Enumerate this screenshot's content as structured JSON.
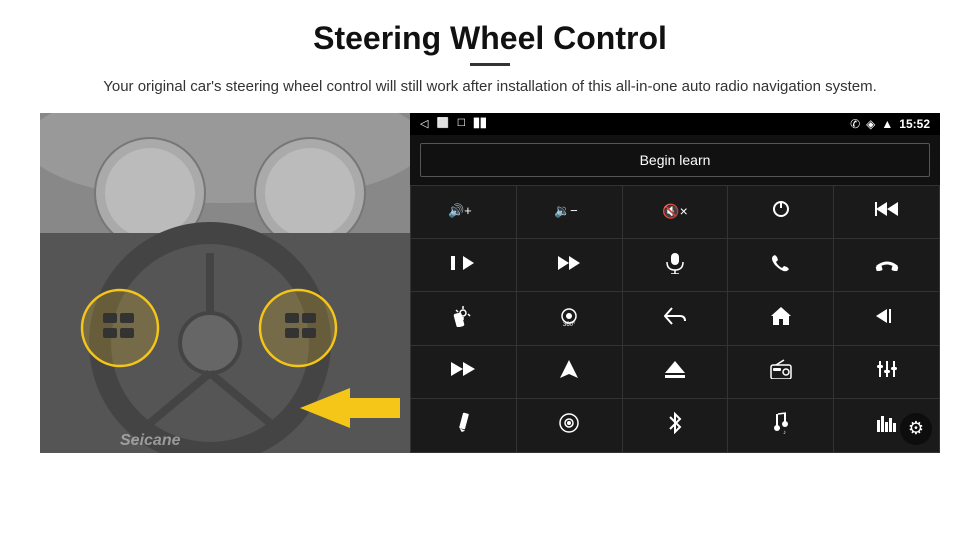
{
  "header": {
    "title": "Steering Wheel Control",
    "divider": true,
    "subtitle": "Your original car's steering wheel control will still work after installation of this all-in-one auto radio navigation system."
  },
  "status_bar": {
    "back_icon": "◁",
    "home_icon": "⬜",
    "recent_icon": "☐",
    "signal_icon": "▊▊",
    "phone_icon": "📞",
    "wifi_icon": "◈",
    "location_icon": "◈",
    "time": "15:52"
  },
  "begin_learn": {
    "label": "Begin learn"
  },
  "controls": [
    {
      "id": "vol-up",
      "icon": "🔊+",
      "label": "volume up"
    },
    {
      "id": "vol-down",
      "icon": "🔉−",
      "label": "volume down"
    },
    {
      "id": "vol-mute",
      "icon": "🔇×",
      "label": "mute"
    },
    {
      "id": "power",
      "icon": "⏻",
      "label": "power"
    },
    {
      "id": "prev-prev",
      "icon": "⏮",
      "label": "previous track"
    },
    {
      "id": "next",
      "icon": "⏭",
      "label": "next"
    },
    {
      "id": "prev-next",
      "icon": "⏭",
      "label": "skip forward"
    },
    {
      "id": "mic",
      "icon": "🎤",
      "label": "microphone"
    },
    {
      "id": "phone",
      "icon": "📞",
      "label": "phone"
    },
    {
      "id": "hangup",
      "icon": "📵",
      "label": "hang up"
    },
    {
      "id": "brightness",
      "icon": "☀",
      "label": "brightness"
    },
    {
      "id": "cam360",
      "icon": "👁",
      "label": "360 camera"
    },
    {
      "id": "back-nav",
      "icon": "↩",
      "label": "back"
    },
    {
      "id": "home-nav",
      "icon": "⌂",
      "label": "home"
    },
    {
      "id": "skip-back",
      "icon": "⏮",
      "label": "skip back"
    },
    {
      "id": "fast-forward",
      "icon": "⏩",
      "label": "fast forward"
    },
    {
      "id": "nav",
      "icon": "▲",
      "label": "navigation"
    },
    {
      "id": "eject",
      "icon": "⏏",
      "label": "eject"
    },
    {
      "id": "radio",
      "icon": "📻",
      "label": "radio"
    },
    {
      "id": "eq",
      "icon": "🎚",
      "label": "equalizer"
    },
    {
      "id": "pen",
      "icon": "✏",
      "label": "edit"
    },
    {
      "id": "media",
      "icon": "⏺",
      "label": "media"
    },
    {
      "id": "bluetooth",
      "icon": "⚡",
      "label": "bluetooth"
    },
    {
      "id": "music",
      "icon": "🎵",
      "label": "music"
    },
    {
      "id": "spectrum",
      "icon": "📊",
      "label": "spectrum"
    }
  ],
  "watermark": "Seicane",
  "gear_label": "⚙"
}
